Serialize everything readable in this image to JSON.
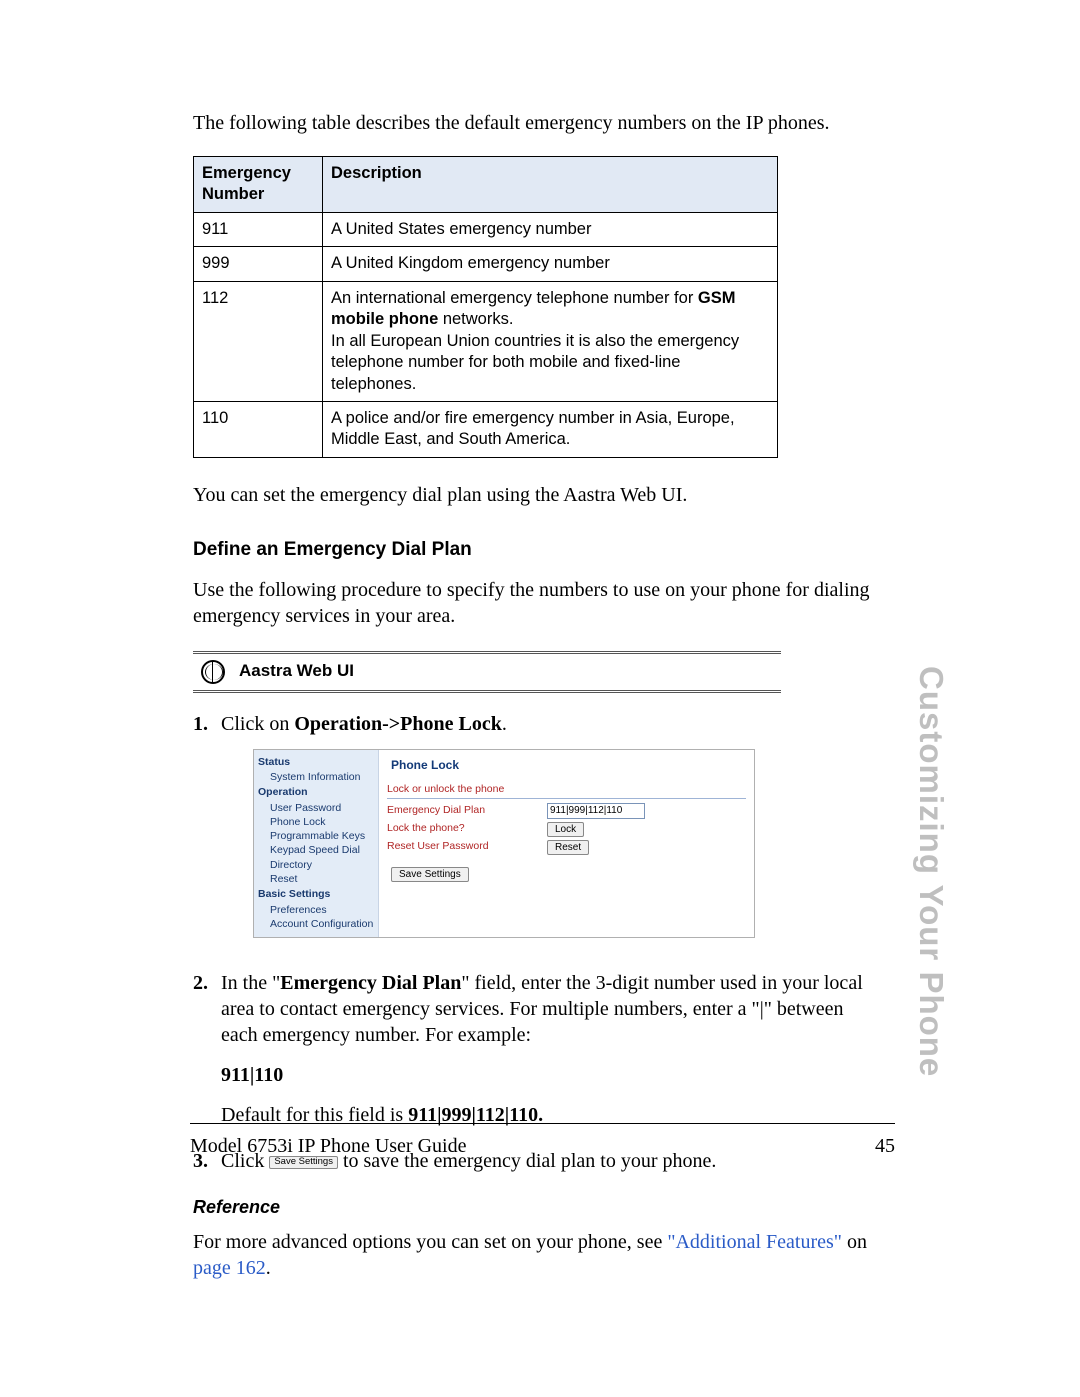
{
  "intro": "The following table describes the default emergency numbers on the IP phones.",
  "table": {
    "headers": [
      "Emergency Number",
      "Description"
    ],
    "rows": [
      {
        "num": "911",
        "desc_plain": "A United States emergency number"
      },
      {
        "num": "999",
        "desc_plain": "A United Kingdom emergency number"
      },
      {
        "num": "112",
        "desc_pre": "An international emergency telephone number for ",
        "desc_bold": "GSM mobile phone",
        "desc_post": " networks.\nIn all European Union countries it is also the emergency telephone number for both mobile and fixed-line telephones."
      },
      {
        "num": "110",
        "desc_plain": "A police and/or fire emergency number in Asia, Europe, Middle East, and South America."
      }
    ]
  },
  "after_table": "You can set the emergency dial plan using the Aastra Web UI.",
  "section_heading": "Define an Emergency Dial Plan",
  "section_body": "Use the following procedure to specify the numbers to use on your phone for dialing emergency services in your area.",
  "aastra_label": "Aastra Web UI",
  "steps": {
    "s1": {
      "num": "1.",
      "pre": "Click on ",
      "bold1": "Operation->Phone Lock",
      "post": "."
    },
    "s2": {
      "num": "2.",
      "pre": "In the \"",
      "bold1": "Emergency Dial Plan",
      "mid": "\" field, enter the 3-digit number used in your local area to contact emergency services. For multiple numbers, enter a \"|\" between each emergency number. For example:",
      "example": "911|110",
      "default_pre": "Default for this field is ",
      "default_bold": "911|999|112|110."
    },
    "s3": {
      "num": "3.",
      "pre": "Click ",
      "btn": "Save Settings",
      "post": " to save the emergency dial plan to your phone."
    }
  },
  "webui": {
    "title": "Phone Lock",
    "side": {
      "sec_status": "Status",
      "sys_info": "System Information",
      "sec_op": "Operation",
      "user_pw": "User Password",
      "phone_lock": "Phone Lock",
      "prog_keys": "Programmable Keys",
      "speed_dial": "Keypad Speed Dial",
      "directory": "Directory",
      "reset": "Reset",
      "sec_basic": "Basic Settings",
      "prefs": "Preferences",
      "acct_cfg": "Account Configuration"
    },
    "sec_header": "Lock or unlock the phone",
    "row_edp": "Emergency Dial Plan",
    "edp_value": "911|999|112|110",
    "row_lock": "Lock the phone?",
    "btn_lock": "Lock",
    "row_reset": "Reset User Password",
    "btn_reset": "Reset",
    "btn_save": "Save Settings"
  },
  "reference": {
    "heading": "Reference",
    "pre": "For more advanced options you can set on your phone, see ",
    "link1": "\"Additional Features\"",
    "mid": " on ",
    "link2": "page 162",
    "post": "."
  },
  "sidetab": "Customizing Your Phone",
  "footer": {
    "left": "Model 6753i IP Phone User Guide",
    "right": "45"
  }
}
